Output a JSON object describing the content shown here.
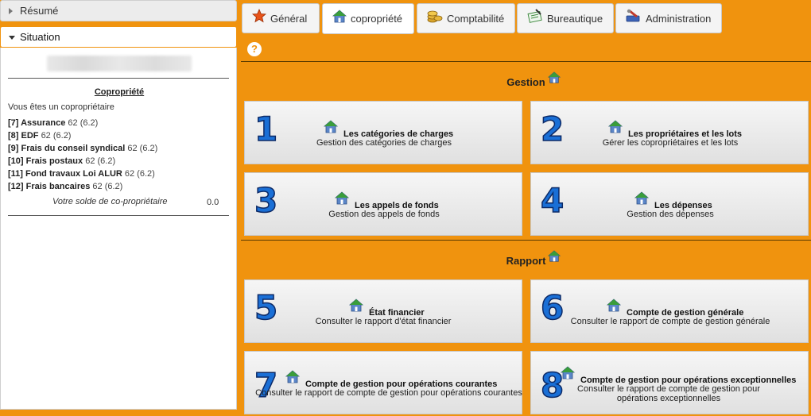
{
  "sidebar": {
    "resume_label": "Résumé",
    "situation_label": "Situation",
    "section_title": "Copropriété",
    "intro": "Vous êtes un copropriétaire",
    "accounts": [
      {
        "code": "[7] Assurance",
        "value": "62 (6.2)"
      },
      {
        "code": "[8] EDF",
        "value": "62 (6.2)"
      },
      {
        "code": "[9] Frais du conseil syndical",
        "value": "62 (6.2)"
      },
      {
        "code": "[10] Frais postaux",
        "value": "62 (6.2)"
      },
      {
        "code": "[11] Fond travaux Loi ALUR",
        "value": "62 (6.2)"
      },
      {
        "code": "[12] Frais bancaires",
        "value": "62 (6.2)"
      }
    ],
    "balance_label": "Votre solde de co-propriétaire",
    "balance_value": "0.0"
  },
  "tabs": [
    {
      "label": "Général",
      "icon": "star-icon"
    },
    {
      "label": "copropriété",
      "icon": "house-icon",
      "active": true
    },
    {
      "label": "Comptabilité",
      "icon": "coins-icon"
    },
    {
      "label": "Bureautique",
      "icon": "document-icon"
    },
    {
      "label": "Administration",
      "icon": "admin-icon"
    }
  ],
  "help_symbol": "?",
  "sections": {
    "gestion": "Gestion",
    "rapport": "Rapport"
  },
  "tiles": [
    {
      "num": "1",
      "title": "Les catégories de charges",
      "desc": "Gestion des catégories de charges"
    },
    {
      "num": "2",
      "title": "Les propriétaires et les lots",
      "desc": "Gérer les copropriétaires et les lots"
    },
    {
      "num": "3",
      "title": "Les appels de fonds",
      "desc": "Gestion des appels de fonds"
    },
    {
      "num": "4",
      "title": "Les dépenses",
      "desc": "Gestion des dépenses"
    },
    {
      "num": "5",
      "title": "État financier",
      "desc": "Consulter le rapport d'état financier"
    },
    {
      "num": "6",
      "title": "Compte de gestion générale",
      "desc": "Consulter le rapport de compte de gestion générale"
    },
    {
      "num": "7",
      "title": "Compte de gestion pour opérations courantes",
      "desc": "Consulter le rapport de compte de gestion pour opérations courantes"
    },
    {
      "num": "8",
      "title": "Compte de gestion pour opérations exceptionnelles",
      "desc": "Consulter le rapport de compte de gestion pour opérations exceptionnelles"
    }
  ],
  "colors": {
    "background": "#f0930e",
    "tile_number": "#1a6fd6",
    "house_roof": "#3a9d3a",
    "house_wall": "#5b86c8"
  }
}
